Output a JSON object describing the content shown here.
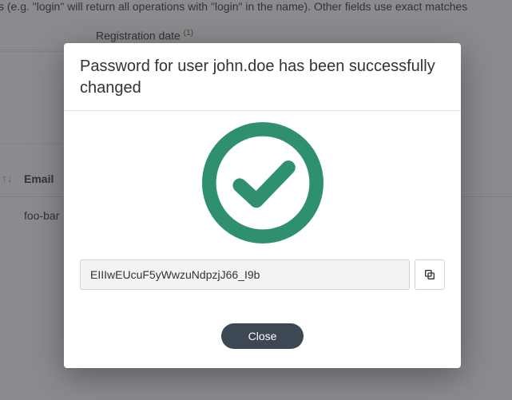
{
  "background": {
    "hint_text": "s (e.g. \"login\" will return all operations with \"login\" in the name). Other fields use exact matches",
    "registration_date_label": "Registration date",
    "registration_date_badge": "(1)",
    "email_header": "Email",
    "sort_glyph": "↑↓",
    "row_email_partial": "foo-bar"
  },
  "modal": {
    "title": "Password for user john.doe has been successfully changed",
    "password_value": "EIIIwEUcuF5yWwzuNdpzjJ66_I9b",
    "close_label": "Close",
    "icon": "success-check-icon",
    "copy_icon": "copy-icon",
    "accent_color": "#2f8f71"
  }
}
